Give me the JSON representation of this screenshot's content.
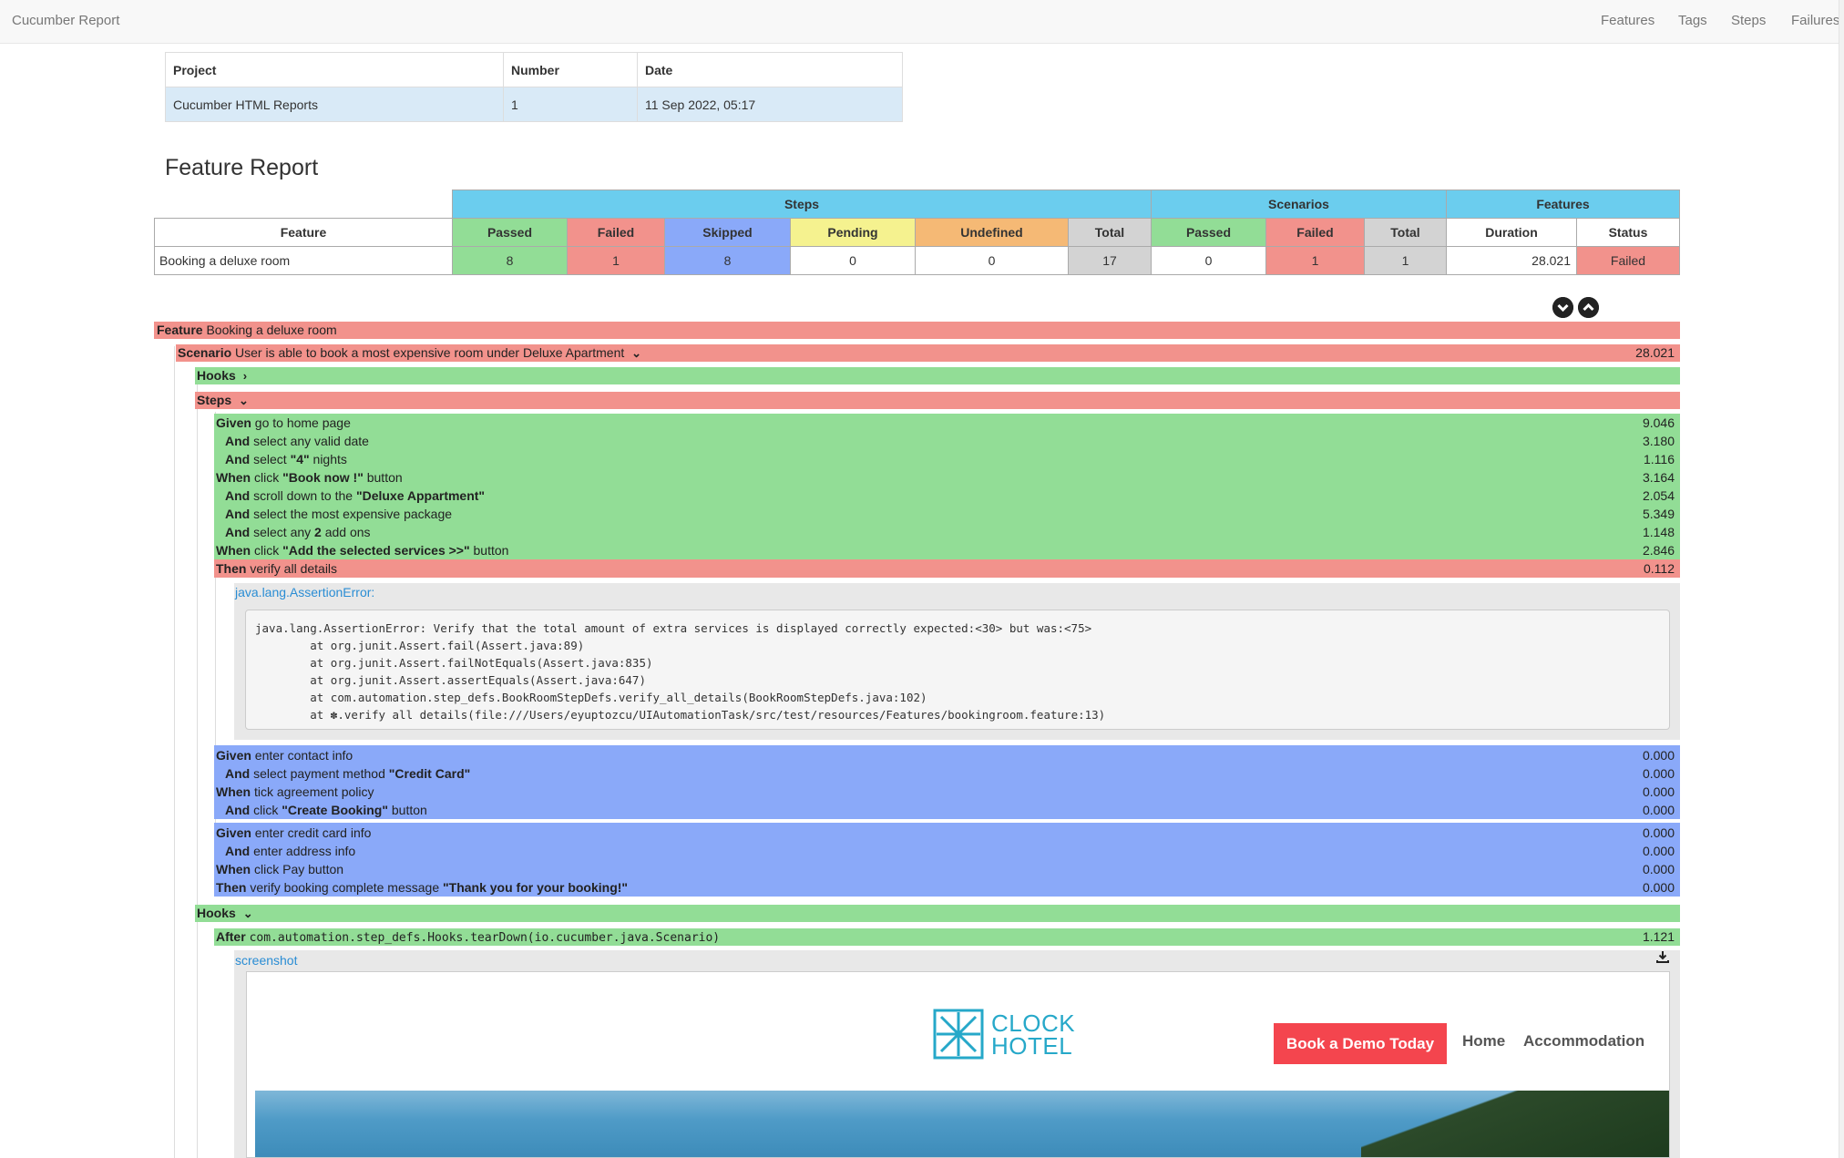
{
  "navbar": {
    "brand": "Cucumber Report",
    "links": [
      "Features",
      "Tags",
      "Steps",
      "Failures"
    ]
  },
  "info": {
    "headers": [
      "Project",
      "Number",
      "Date"
    ],
    "values": [
      "Cucumber HTML Reports",
      "1",
      "11 Sep 2022, 05:17"
    ]
  },
  "report_title": "Feature Report",
  "stats": {
    "groups": [
      "Steps",
      "Scenarios",
      "Features"
    ],
    "headers": [
      "Feature",
      "Passed",
      "Failed",
      "Skipped",
      "Pending",
      "Undefined",
      "Total",
      "Passed",
      "Failed",
      "Total",
      "Duration",
      "Status"
    ],
    "row": [
      "Booking a deluxe room",
      "8",
      "1",
      "8",
      "0",
      "0",
      "17",
      "0",
      "1",
      "1",
      "28.021",
      "Failed"
    ]
  },
  "controls": {
    "expand_icon": "chevron-down-circle-icon",
    "collapse_icon": "chevron-up-circle-icon"
  },
  "feature": {
    "keyword": "Feature",
    "name": "Booking a deluxe room"
  },
  "scenario": {
    "keyword": "Scenario",
    "name": "User is able to book a most expensive room under Deluxe Apartment",
    "duration": "28.021"
  },
  "hooks_label": "Hooks",
  "steps_label": "Steps",
  "steps": [
    {
      "kw": "Given",
      "pre": "go to home page",
      "bold": "",
      "post": "",
      "dur": "9.046"
    },
    {
      "kw": "And",
      "pre": "select any valid date",
      "bold": "",
      "post": "",
      "dur": "3.180"
    },
    {
      "kw": "And",
      "pre": "select ",
      "bold": "\"4\"",
      "post": " nights",
      "dur": "1.116"
    },
    {
      "kw": "When",
      "pre": "click ",
      "bold": "\"Book now !\"",
      "post": " button",
      "dur": "3.164"
    },
    {
      "kw": "And",
      "pre": "scroll down to the ",
      "bold": "\"Deluxe Appartment\"",
      "post": "",
      "dur": "2.054"
    },
    {
      "kw": "And",
      "pre": "select the most expensive package",
      "bold": "",
      "post": "",
      "dur": "5.349"
    },
    {
      "kw": "And",
      "pre": "select any ",
      "bold": "2",
      "post": " add ons",
      "dur": "1.148"
    },
    {
      "kw": "When",
      "pre": "click ",
      "bold": "\"Add the selected services >>\"",
      "post": " button",
      "dur": "2.846"
    },
    {
      "kw": "Then",
      "pre": "verify all details",
      "bold": "",
      "post": "",
      "dur": "0.112"
    }
  ],
  "error": {
    "link": "java.lang.AssertionError:",
    "trace": "java.lang.AssertionError: Verify that the total amount of extra services is displayed correctly expected:<30> but was:<75>\n\tat org.junit.Assert.fail(Assert.java:89)\n\tat org.junit.Assert.failNotEquals(Assert.java:835)\n\tat org.junit.Assert.assertEquals(Assert.java:647)\n\tat com.automation.step_defs.BookRoomStepDefs.verify_all_details(BookRoomStepDefs.java:102)\n\tat ✽.verify all details(file:///Users/eyuptozcu/UIAutomationTask/src/test/resources/Features/bookingroom.feature:13)"
  },
  "skipped_group1": [
    {
      "kw": "Given",
      "pre": "enter contact info",
      "bold": "",
      "post": "",
      "dur": "0.000"
    },
    {
      "kw": "And",
      "pre": "select payment method ",
      "bold": "\"Credit Card\"",
      "post": "",
      "dur": "0.000"
    },
    {
      "kw": "When",
      "pre": "tick agreement policy",
      "bold": "",
      "post": "",
      "dur": "0.000"
    },
    {
      "kw": "And",
      "pre": "click ",
      "bold": "\"Create Booking\"",
      "post": " button",
      "dur": "0.000"
    }
  ],
  "skipped_group2": [
    {
      "kw": "Given",
      "pre": "enter credit card info",
      "bold": "",
      "post": "",
      "dur": "0.000"
    },
    {
      "kw": "And",
      "pre": "enter address info",
      "bold": "",
      "post": "",
      "dur": "0.000"
    },
    {
      "kw": "When",
      "pre": "click Pay button",
      "bold": "",
      "post": "",
      "dur": "0.000"
    },
    {
      "kw": "Then",
      "pre": "verify booking complete message ",
      "bold": "\"Thank you for your booking!\"",
      "post": "",
      "dur": "0.000"
    }
  ],
  "after_hook": {
    "kw": "After",
    "method": "com.automation.step_defs.Hooks.tearDown(io.cucumber.java.Scenario)",
    "dur": "1.121"
  },
  "screenshot": {
    "link": "screenshot",
    "logo_line1": "CLOCK",
    "logo_line2": "HOTEL",
    "demo_button": "Book a Demo Today",
    "nav_home": "Home",
    "nav_accommodation": "Accommodation"
  },
  "colors": {
    "passed": "#92dd96",
    "failed": "#f2928c",
    "skipped": "#8aa9f9",
    "pending": "#f5f28f",
    "undefined": "#f5b975",
    "header": "#6bcdee",
    "link": "#2a8dd4"
  }
}
